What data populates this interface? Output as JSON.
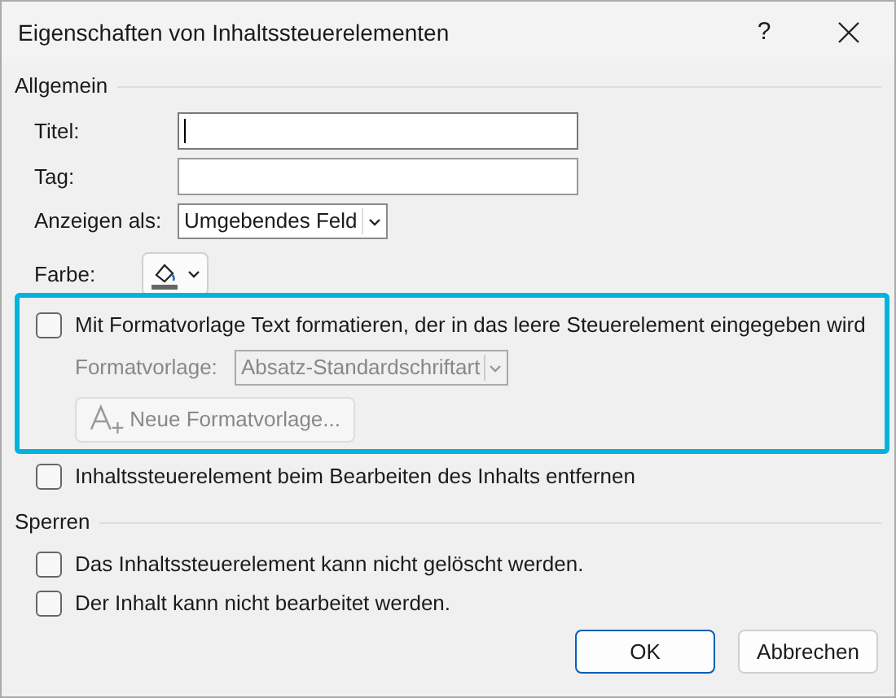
{
  "window": {
    "title": "Eigenschaften von Inhaltssteuerelementen",
    "help": "?"
  },
  "general": {
    "heading": "Allgemein",
    "fields": [
      {
        "label": "Titel:",
        "focused": true
      },
      {
        "label": "Tag:",
        "focused": false
      }
    ],
    "display": {
      "label": "Anzeigen als:",
      "value": "Umgebendes Feld"
    },
    "color": {
      "label": "Farbe:"
    },
    "style_group": {
      "highlighted": true,
      "checkbox": {
        "label": "Mit Formatvorlage Text formatieren, der in das leere Steuerelement eingegeben wird",
        "checked": false
      },
      "style": {
        "label": "Formatvorlage:",
        "value": "Absatz-Standardschriftart",
        "disabled": true
      },
      "new_style_button": {
        "label": "Neue Formatvorlage...",
        "disabled": true
      }
    },
    "remove_checkbox": {
      "label": "Inhaltssteuerelement beim Bearbeiten des Inhalts entfernen",
      "checked": false
    }
  },
  "locking": {
    "heading": "Sperren",
    "checkboxes": [
      {
        "label": "Das Inhaltssteuerelement kann nicht gelöscht werden.",
        "checked": false
      },
      {
        "label": "Der Inhalt kann nicht bearbeitet werden.",
        "checked": false
      }
    ]
  },
  "buttons": [
    {
      "label": "OK",
      "default": true
    },
    {
      "label": "Abbrechen",
      "default": false
    }
  ]
}
